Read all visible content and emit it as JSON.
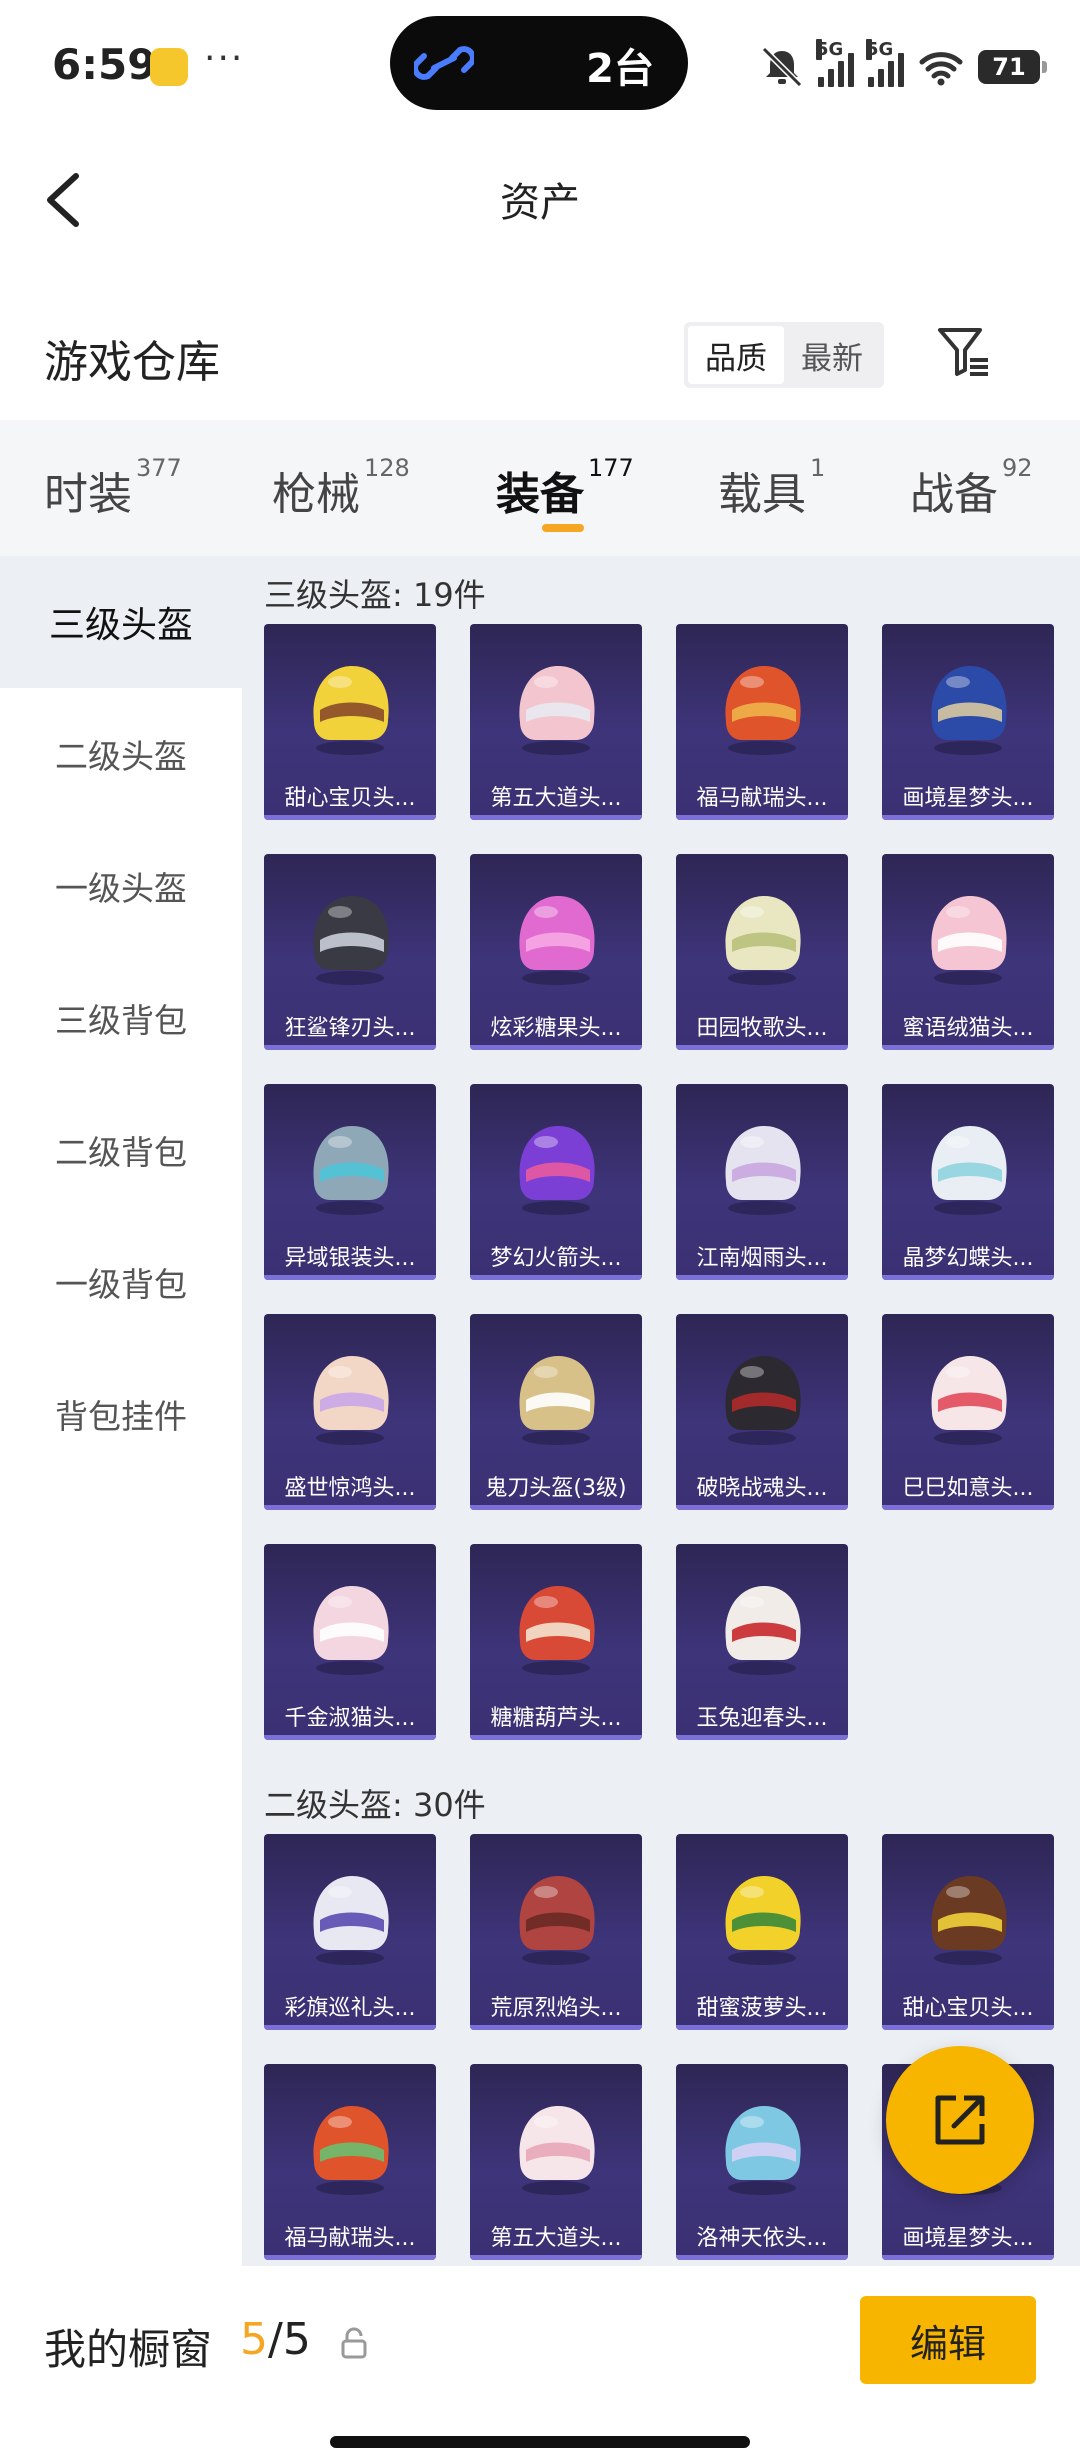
{
  "status_bar": {
    "time": "6:59",
    "island_text": "2台",
    "battery": "71",
    "signal_label": "5G"
  },
  "header": {
    "title": "资产"
  },
  "section": {
    "title": "游戏仓库",
    "sort_options": [
      "品质",
      "最新"
    ],
    "active_sort": 0
  },
  "tabs": [
    {
      "label": "时装",
      "count": "377"
    },
    {
      "label": "枪械",
      "count": "128"
    },
    {
      "label": "装备",
      "count": "177"
    },
    {
      "label": "载具",
      "count": "1"
    },
    {
      "label": "战备",
      "count": "92"
    }
  ],
  "active_tab": 2,
  "sidebar": {
    "items": [
      "三级头盔",
      "二级头盔",
      "一级头盔",
      "三级背包",
      "二级背包",
      "一级背包",
      "背包挂件"
    ],
    "active": 0
  },
  "groups": [
    {
      "title": "三级头盔: 19件",
      "items": [
        {
          "name": "甜心宝贝头...",
          "color": "#f2d23a",
          "accent": "#8a4a2a"
        },
        {
          "name": "第五大道头...",
          "color": "#f3c6cf",
          "accent": "#e9e9f0"
        },
        {
          "name": "福马献瑞头...",
          "color": "#e0542c",
          "accent": "#f0b24a"
        },
        {
          "name": "画境星梦头...",
          "color": "#2c4aa8",
          "accent": "#d8c9a0"
        },
        {
          "name": "狂鲨锋刃头...",
          "color": "#3a3a44",
          "accent": "#c9ced8"
        },
        {
          "name": "炫彩糖果头...",
          "color": "#e06ad0",
          "accent": "#f7a9e4"
        },
        {
          "name": "田园牧歌头...",
          "color": "#e9e6c2",
          "accent": "#b9c07a"
        },
        {
          "name": "蜜语绒猫头...",
          "color": "#f5c5d3",
          "accent": "#ffffff"
        },
        {
          "name": "异域银装头...",
          "color": "#8fa8b8",
          "accent": "#4fc3d8"
        },
        {
          "name": "梦幻火箭头...",
          "color": "#7b3fd6",
          "accent": "#e85aa0"
        },
        {
          "name": "江南烟雨头...",
          "color": "#e6e3f0",
          "accent": "#c8a6e0"
        },
        {
          "name": "晶梦幻蝶头...",
          "color": "#e8eef3",
          "accent": "#8fd3df"
        },
        {
          "name": "盛世惊鸿头...",
          "color": "#f3d7c6",
          "accent": "#c9a7e8"
        },
        {
          "name": "鬼刀头盔(3级)",
          "color": "#d8c089",
          "accent": "#ffffff"
        },
        {
          "name": "破晓战魂头...",
          "color": "#2c2a30",
          "accent": "#b02a2a"
        },
        {
          "name": "巳巳如意头...",
          "color": "#f7e6e8",
          "accent": "#e24a5a"
        },
        {
          "name": "千金淑猫头...",
          "color": "#f3d6e0",
          "accent": "#ffffff"
        },
        {
          "name": "糖糖葫芦头...",
          "color": "#d94a36",
          "accent": "#f3e3cf"
        },
        {
          "name": "玉兔迎春头...",
          "color": "#f1ece8",
          "accent": "#c8282a"
        }
      ]
    },
    {
      "title": "二级头盔: 30件",
      "items": [
        {
          "name": "彩旗巡礼头...",
          "color": "#e8e8f3",
          "accent": "#5a4ab0"
        },
        {
          "name": "荒原烈焰头...",
          "color": "#b04440",
          "accent": "#6a2a26"
        },
        {
          "name": "甜蜜菠萝头...",
          "color": "#f2d22a",
          "accent": "#3a8a3a"
        },
        {
          "name": "甜心宝贝头...",
          "color": "#6a3a22",
          "accent": "#f2d23a"
        },
        {
          "name": "福马献瑞头...",
          "color": "#e0542c",
          "accent": "#6abf70"
        },
        {
          "name": "第五大道头...",
          "color": "#f6e6ea",
          "accent": "#e9a6b8"
        },
        {
          "name": "洛神天依头...",
          "color": "#7ec8e3",
          "accent": "#d8d2f5"
        },
        {
          "name": "画境星梦头...",
          "color": "#2c3f8a",
          "accent": "#d8c9a0"
        }
      ]
    }
  ],
  "bottom_bar": {
    "label": "我的橱窗",
    "current": "5",
    "total": "/5",
    "edit_label": "编辑"
  },
  "colors": {
    "accent": "#f7b500",
    "card_bg": "#3e347a",
    "content_bg": "#eceff3"
  }
}
